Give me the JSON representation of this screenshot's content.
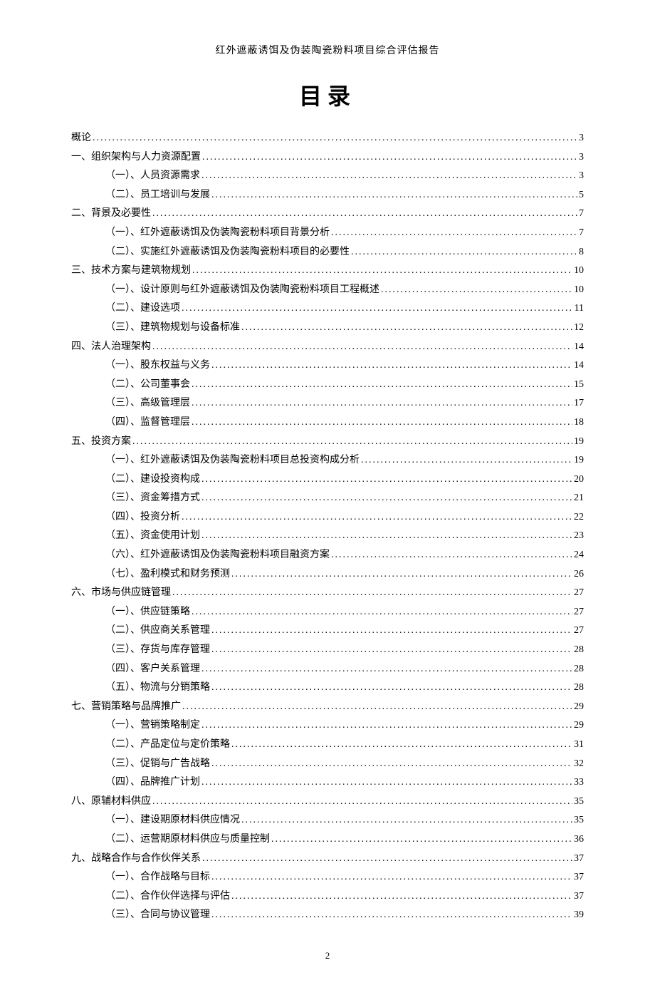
{
  "header": "红外遮蔽诱饵及伪装陶瓷粉料项目综合评估报告",
  "title": "目录",
  "page_number": "2",
  "toc": [
    {
      "level": 1,
      "text": "概论",
      "page": "3"
    },
    {
      "level": 1,
      "text": "一、组织架构与人力资源配置",
      "page": "3"
    },
    {
      "level": 2,
      "text": "（一）、人员资源需求",
      "page": "3"
    },
    {
      "level": 2,
      "text": "（二）、员工培训与发展",
      "page": "5"
    },
    {
      "level": 1,
      "text": "二、背景及必要性",
      "page": "7"
    },
    {
      "level": 2,
      "text": "（一）、红外遮蔽诱饵及伪装陶瓷粉料项目背景分析",
      "page": "7"
    },
    {
      "level": 2,
      "text": "（二）、实施红外遮蔽诱饵及伪装陶瓷粉料项目的必要性",
      "page": "8"
    },
    {
      "level": 1,
      "text": "三、技术方案与建筑物规划",
      "page": "10"
    },
    {
      "level": 2,
      "text": "（一）、设计原则与红外遮蔽诱饵及伪装陶瓷粉料项目工程概述",
      "page": "10"
    },
    {
      "level": 2,
      "text": "（二）、建设选项",
      "page": "11"
    },
    {
      "level": 2,
      "text": "（三）、建筑物规划与设备标准",
      "page": "12"
    },
    {
      "level": 1,
      "text": "四、法人治理架构",
      "page": "14"
    },
    {
      "level": 2,
      "text": "（一）、股东权益与义务",
      "page": "14"
    },
    {
      "level": 2,
      "text": "（二）、公司董事会",
      "page": "15"
    },
    {
      "level": 2,
      "text": "（三）、高级管理层",
      "page": "17"
    },
    {
      "level": 2,
      "text": "（四）、监督管理层",
      "page": "18"
    },
    {
      "level": 1,
      "text": "五、投资方案",
      "page": "19"
    },
    {
      "level": 2,
      "text": "（一）、红外遮蔽诱饵及伪装陶瓷粉料项目总投资构成分析",
      "page": "19"
    },
    {
      "level": 2,
      "text": "（二）、建设投资构成",
      "page": "20"
    },
    {
      "level": 2,
      "text": "（三）、资金筹措方式",
      "page": "21"
    },
    {
      "level": 2,
      "text": "（四）、投资分析",
      "page": "22"
    },
    {
      "level": 2,
      "text": "（五）、资金使用计划",
      "page": "23"
    },
    {
      "level": 2,
      "text": "（六）、红外遮蔽诱饵及伪装陶瓷粉料项目融资方案",
      "page": "24"
    },
    {
      "level": 2,
      "text": "（七）、盈利模式和财务预测",
      "page": "26"
    },
    {
      "level": 1,
      "text": "六、市场与供应链管理",
      "page": "27"
    },
    {
      "level": 2,
      "text": "（一）、供应链策略",
      "page": "27"
    },
    {
      "level": 2,
      "text": "（二）、供应商关系管理",
      "page": "27"
    },
    {
      "level": 2,
      "text": "（三）、存货与库存管理",
      "page": "28"
    },
    {
      "level": 2,
      "text": "（四）、客户关系管理",
      "page": "28"
    },
    {
      "level": 2,
      "text": "（五）、物流与分销策略",
      "page": "28"
    },
    {
      "level": 1,
      "text": "七、营销策略与品牌推广",
      "page": "29"
    },
    {
      "level": 2,
      "text": "（一）、营销策略制定",
      "page": "29"
    },
    {
      "level": 2,
      "text": "（二）、产品定位与定价策略",
      "page": "31"
    },
    {
      "level": 2,
      "text": "（三）、促销与广告战略",
      "page": "32"
    },
    {
      "level": 2,
      "text": "（四）、品牌推广计划",
      "page": "33"
    },
    {
      "level": 1,
      "text": "八、原辅材料供应",
      "page": "35"
    },
    {
      "level": 2,
      "text": "（一）、建设期原材料供应情况",
      "page": "35"
    },
    {
      "level": 2,
      "text": "（二）、运营期原材料供应与质量控制",
      "page": "36"
    },
    {
      "level": 1,
      "text": "九、战略合作与合作伙伴关系",
      "page": "37"
    },
    {
      "level": 2,
      "text": "（一）、合作战略与目标",
      "page": "37"
    },
    {
      "level": 2,
      "text": "（二）、合作伙伴选择与评估",
      "page": "37"
    },
    {
      "level": 2,
      "text": "（三）、合同与协议管理",
      "page": "39"
    }
  ]
}
